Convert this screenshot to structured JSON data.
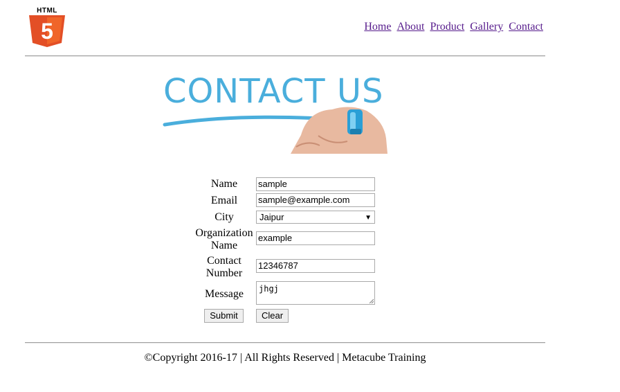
{
  "logo": {
    "text": "HTML",
    "digit": "5"
  },
  "nav": {
    "items": [
      "Home",
      "About",
      "Product",
      "Gallery",
      "Contact"
    ]
  },
  "banner": {
    "title": "CONTACT US"
  },
  "form": {
    "name": {
      "label": "Name",
      "value": "sample"
    },
    "email": {
      "label": "Email",
      "value": "sample@example.com"
    },
    "city": {
      "label": "City",
      "value": "Jaipur"
    },
    "organization": {
      "label_line1": "Organization",
      "label_line2": "Name",
      "value": "example"
    },
    "contact": {
      "label_line1": "Contact",
      "label_line2": "Number",
      "value": "12346787"
    },
    "message": {
      "label": "Message",
      "value": "jhgj"
    },
    "submit_label": "Submit",
    "clear_label": "Clear"
  },
  "footer": {
    "text": "©Copyright 2016-17 | All Rights Reserved | Metacube Training"
  },
  "colors": {
    "logo_orange": "#e34f26",
    "banner_blue": "#4aaedc",
    "link": "#551a8b"
  }
}
